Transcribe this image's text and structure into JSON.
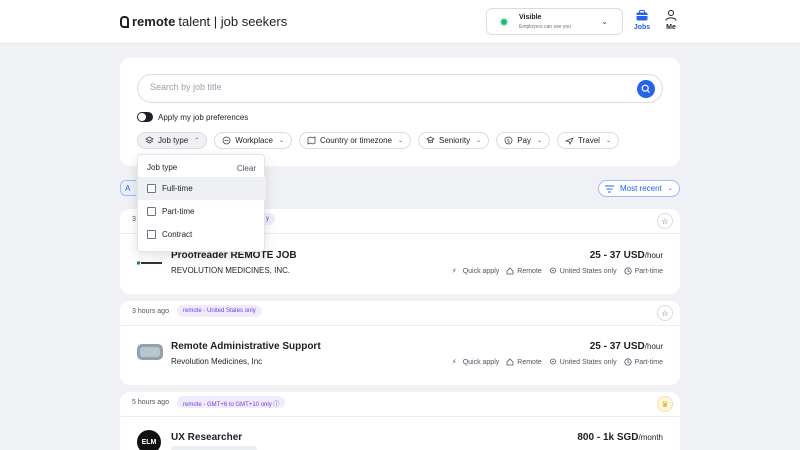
{
  "header": {
    "brand": "remote",
    "brand_suffix": "talent | job seekers",
    "visibility": {
      "title": "Visible",
      "subtitle": "Employers can see you"
    },
    "nav": [
      {
        "label": "Jobs"
      },
      {
        "label": "Me"
      }
    ]
  },
  "search": {
    "placeholder": "Search by job title",
    "apply_prefs_label": "Apply my job preferences",
    "filters": [
      {
        "label": "Job type",
        "icon": "layers-icon"
      },
      {
        "label": "Workplace",
        "icon": "building-icon"
      },
      {
        "label": "Country or timezone",
        "icon": "map-icon"
      },
      {
        "label": "Seniority",
        "icon": "badge-icon"
      },
      {
        "label": "Pay",
        "icon": "money-icon"
      },
      {
        "label": "Travel",
        "icon": "plane-icon"
      }
    ]
  },
  "sort": {
    "tab_partial": "A",
    "label": "Most recent"
  },
  "dropdown": {
    "title": "Job type",
    "clear_label": "Clear",
    "options": [
      {
        "label": "Full-time"
      },
      {
        "label": "Part-time"
      },
      {
        "label": "Contract"
      }
    ]
  },
  "jobs": [
    {
      "age": "3",
      "tag": "y",
      "title": "Proofreader REMOTE JOB",
      "company": "REVOLUTION MEDICINES, INC.",
      "salary": "25 - 37 USD",
      "salary_unit": "/hour",
      "meta": [
        "Quick apply",
        "Remote",
        "United States only",
        "Part-time"
      ]
    },
    {
      "age": "3 hours ago",
      "tag": "remote - United States only",
      "title": "Remote Administrative Support",
      "company": "Revolution Medicines, Inc",
      "salary": "25 - 37 USD",
      "salary_unit": "/hour",
      "meta": [
        "Quick apply",
        "Remote",
        "United States only",
        "Part-time"
      ]
    },
    {
      "age": "5 hours ago",
      "tag": "remote - GMT+6 to GMT+10 only",
      "title": "UX Researcher",
      "company": "",
      "salary": "800 - 1k SGD",
      "salary_unit": "/month",
      "logo_text": "ELM"
    }
  ],
  "colors": {
    "accent": "#2563eb",
    "tag_bg": "#f1ecfd",
    "tag_text": "#6d3fd8",
    "visible_dot": "#22b873"
  }
}
